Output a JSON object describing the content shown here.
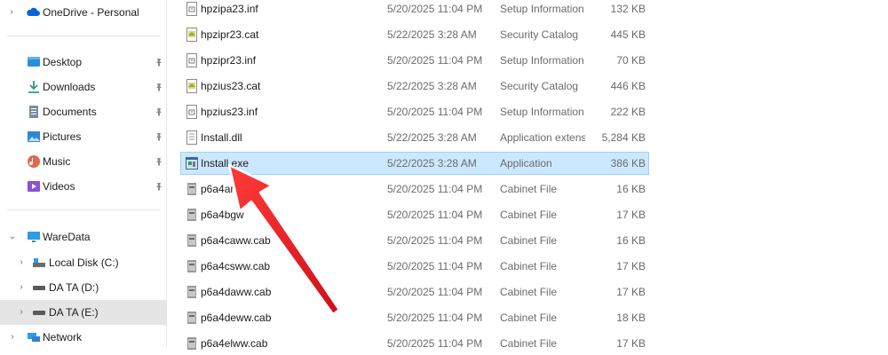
{
  "nav": {
    "onedrive": "OneDrive - Personal",
    "quick": [
      {
        "label": "Desktop",
        "icon": "desktop-icon"
      },
      {
        "label": "Downloads",
        "icon": "downloads-icon"
      },
      {
        "label": "Documents",
        "icon": "documents-icon"
      },
      {
        "label": "Pictures",
        "icon": "pictures-icon"
      },
      {
        "label": "Music",
        "icon": "music-icon"
      },
      {
        "label": "Videos",
        "icon": "videos-icon"
      }
    ],
    "pc": "WareData",
    "drives": [
      {
        "label": "Local Disk (C:)",
        "icon": "local-disk-icon",
        "selected": false
      },
      {
        "label": "DA TA (D:)",
        "icon": "drive-icon",
        "selected": false
      },
      {
        "label": "DA TA (E:)",
        "icon": "drive-icon",
        "selected": true
      }
    ],
    "network": "Network"
  },
  "files": [
    {
      "name": "hpzipa23.inf",
      "date": "5/20/2025 11:04 PM",
      "type": "Setup Information",
      "size": "132 KB",
      "icon": "inf-file-icon",
      "selected": false
    },
    {
      "name": "hpzipr23.cat",
      "date": "5/22/2025 3:28 AM",
      "type": "Security Catalog",
      "size": "445 KB",
      "icon": "catalog-file-icon",
      "selected": false
    },
    {
      "name": "hpzipr23.inf",
      "date": "5/20/2025 11:04 PM",
      "type": "Setup Information",
      "size": "70 KB",
      "icon": "inf-file-icon",
      "selected": false
    },
    {
      "name": "hpzius23.cat",
      "date": "5/22/2025 3:28 AM",
      "type": "Security Catalog",
      "size": "446 KB",
      "icon": "catalog-file-icon",
      "selected": false
    },
    {
      "name": "hpzius23.inf",
      "date": "5/20/2025 11:04 PM",
      "type": "Setup Information",
      "size": "222 KB",
      "icon": "inf-file-icon",
      "selected": false
    },
    {
      "name": "Install.dll",
      "date": "5/22/2025 3:28 AM",
      "type": "Application extens...",
      "size": "5,284 KB",
      "icon": "dll-file-icon",
      "selected": false
    },
    {
      "name": "Install.exe",
      "date": "5/22/2025 3:28 AM",
      "type": "Application",
      "size": "386 KB",
      "icon": "exe-file-icon",
      "selected": true
    },
    {
      "name": "p6a4an",
      "date": "5/20/2025 11:04 PM",
      "type": "Cabinet File",
      "size": "16 KB",
      "icon": "cab-file-icon",
      "selected": false
    },
    {
      "name": "p6a4bgw",
      "date": "5/20/2025 11:04 PM",
      "type": "Cabinet File",
      "size": "17 KB",
      "icon": "cab-file-icon",
      "selected": false
    },
    {
      "name": "p6a4caww.cab",
      "date": "5/20/2025 11:04 PM",
      "type": "Cabinet File",
      "size": "16 KB",
      "icon": "cab-file-icon",
      "selected": false
    },
    {
      "name": "p6a4csww.cab",
      "date": "5/20/2025 11:04 PM",
      "type": "Cabinet File",
      "size": "17 KB",
      "icon": "cab-file-icon",
      "selected": false
    },
    {
      "name": "p6a4daww.cab",
      "date": "5/20/2025 11:04 PM",
      "type": "Cabinet File",
      "size": "17 KB",
      "icon": "cab-file-icon",
      "selected": false
    },
    {
      "name": "p6a4deww.cab",
      "date": "5/20/2025 11:04 PM",
      "type": "Cabinet File",
      "size": "18 KB",
      "icon": "cab-file-icon",
      "selected": false
    },
    {
      "name": "p6a4elww.cab",
      "date": "5/20/2025 11:04 PM",
      "type": "Cabinet File",
      "size": "17 KB",
      "icon": "cab-file-icon",
      "selected": false
    }
  ],
  "colors": {
    "selection": "#cce8ff",
    "selection_border": "#99d1ff",
    "arrow": "#e8141b",
    "nav_selected": "#e5e5e5"
  }
}
